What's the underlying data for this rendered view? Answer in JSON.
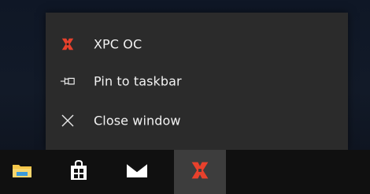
{
  "jump_list": {
    "app_item": {
      "label": "XPC OC",
      "icon": "xpc-logo-icon"
    },
    "tasks": [
      {
        "label": "Pin to taskbar",
        "icon": "pin-icon"
      },
      {
        "label": "Close window",
        "icon": "close-icon"
      }
    ]
  },
  "taskbar": {
    "buttons": [
      {
        "icon": "file-explorer-icon",
        "active": false
      },
      {
        "icon": "store-icon",
        "active": false
      },
      {
        "icon": "mail-icon",
        "active": false
      },
      {
        "icon": "xpc-logo-icon",
        "active": true
      }
    ]
  },
  "colors": {
    "menu_background": "#2b2b2b",
    "taskbar_background": "#101010",
    "active_button_background": "#3d3d3d",
    "xpc_accent": "#e8412c",
    "folder_yellow": "#f4c64a",
    "folder_blue": "#3a9ad9"
  }
}
